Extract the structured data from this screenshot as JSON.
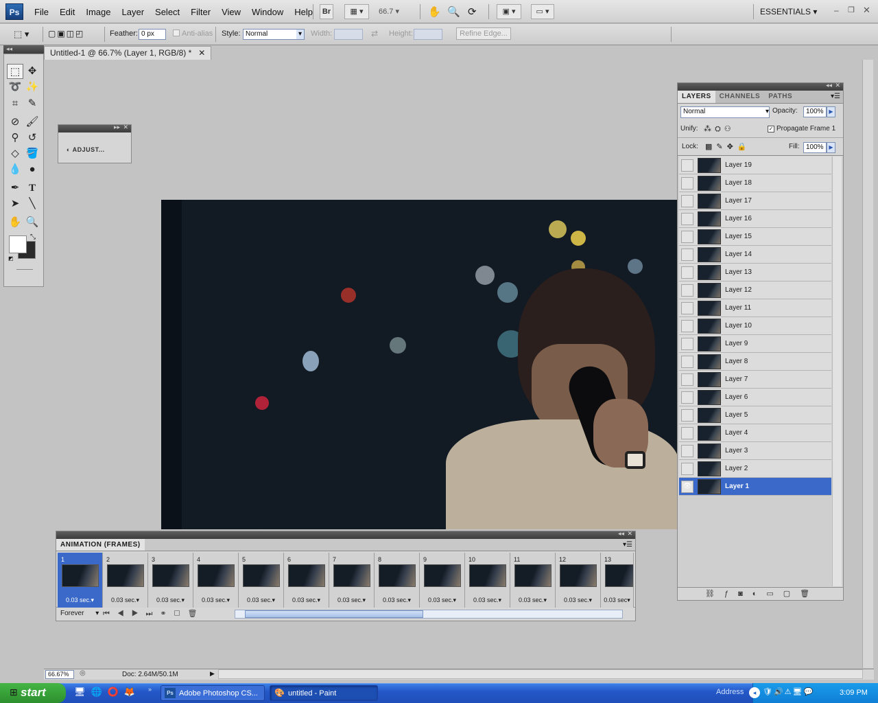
{
  "app": {
    "logo": "Ps"
  },
  "menu": [
    "File",
    "Edit",
    "Image",
    "Layer",
    "Select",
    "Filter",
    "View",
    "Window",
    "Help"
  ],
  "appbar": {
    "br": "Br",
    "zoom": "66.7",
    "workspace": "ESSENTIALS"
  },
  "options": {
    "feather_label": "Feather:",
    "feather_value": "0 px",
    "antialias": "Anti-alias",
    "style_label": "Style:",
    "style_value": "Normal",
    "width_label": "Width:",
    "height_label": "Height:",
    "refine_edge": "Refine Edge..."
  },
  "document": {
    "tab_title": "Untitled-1 @ 66.7% (Layer 1, RGB/8) *"
  },
  "adjust_panel": {
    "label": "ADJUST..."
  },
  "layers_panel": {
    "tabs": [
      "LAYERS",
      "CHANNELS",
      "PATHS"
    ],
    "blend_mode": "Normal",
    "opacity_label": "Opacity:",
    "opacity_value": "100%",
    "unify_label": "Unify:",
    "propagate_label": "Propagate Frame 1",
    "lock_label": "Lock:",
    "fill_label": "Fill:",
    "fill_value": "100%",
    "layers": [
      "Layer 19",
      "Layer 18",
      "Layer 17",
      "Layer 16",
      "Layer 15",
      "Layer 14",
      "Layer 13",
      "Layer 12",
      "Layer 11",
      "Layer 10",
      "Layer 9",
      "Layer 8",
      "Layer 7",
      "Layer 6",
      "Layer 5",
      "Layer 4",
      "Layer 3",
      "Layer 2",
      "Layer 1"
    ],
    "selected_layer": "Layer 1"
  },
  "animation_panel": {
    "title": "ANIMATION (FRAMES)",
    "frames": [
      {
        "n": "1",
        "delay": "0.03 sec."
      },
      {
        "n": "2",
        "delay": "0.03 sec."
      },
      {
        "n": "3",
        "delay": "0.03 sec."
      },
      {
        "n": "4",
        "delay": "0.03 sec."
      },
      {
        "n": "5",
        "delay": "0.03 sec."
      },
      {
        "n": "6",
        "delay": "0.03 sec."
      },
      {
        "n": "7",
        "delay": "0.03 sec."
      },
      {
        "n": "8",
        "delay": "0.03 sec."
      },
      {
        "n": "9",
        "delay": "0.03 sec."
      },
      {
        "n": "10",
        "delay": "0.03 sec."
      },
      {
        "n": "11",
        "delay": "0.03 sec."
      },
      {
        "n": "12",
        "delay": "0.03 sec."
      },
      {
        "n": "13",
        "delay": "0.03 sec"
      }
    ],
    "loop": "Forever"
  },
  "status": {
    "zoom": "66.67%",
    "doc": "Doc: 2.64M/50.1M"
  },
  "taskbar": {
    "start": "start",
    "tasks": [
      "Adobe Photoshop CS...",
      "untitled - Paint"
    ],
    "address": "Address",
    "clock": "3:09 PM"
  },
  "colors": {
    "selection": "#3a69c9",
    "taskbar": "#2457c7",
    "start": "#2c8f2c"
  }
}
